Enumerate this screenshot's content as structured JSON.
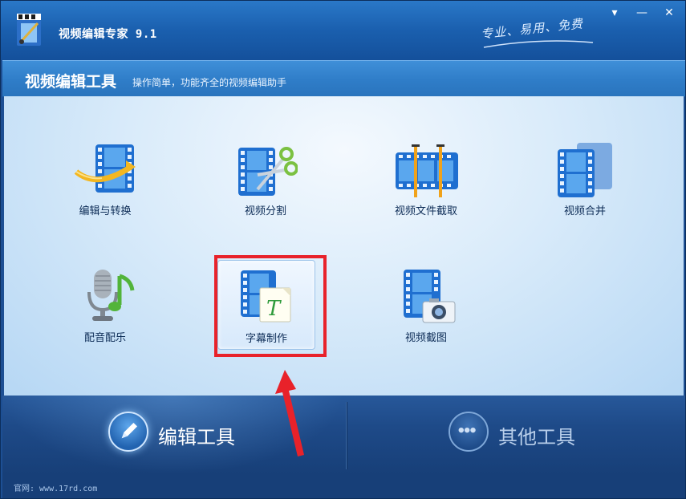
{
  "window": {
    "title": "视频编辑专家 9.1",
    "slogan": "专业、易用、免费",
    "controls": {
      "menu": "▾",
      "minimize": "—",
      "close": "✕"
    }
  },
  "header": {
    "title": "视频编辑工具",
    "subtitle": "操作简单，功能齐全的视频编辑助手"
  },
  "tools": [
    {
      "label": "编辑与转换",
      "icon": "film-convert-icon"
    },
    {
      "label": "视频分割",
      "icon": "film-scissors-icon"
    },
    {
      "label": "视频文件截取",
      "icon": "film-trim-icon"
    },
    {
      "label": "视频合并",
      "icon": "film-merge-icon"
    },
    {
      "label": "配音配乐",
      "icon": "microphone-music-icon"
    },
    {
      "label": "字幕制作",
      "icon": "film-subtitle-icon",
      "selected": true
    },
    {
      "label": "视频截图",
      "icon": "film-camera-icon"
    }
  ],
  "bottom_nav": {
    "edit_tools": {
      "label": "编辑工具",
      "icon": "pencil-icon",
      "active": true
    },
    "other_tools": {
      "label": "其他工具",
      "icon": "more-dots-icon",
      "active": false
    }
  },
  "footer": {
    "text": "官网: www.17rd.com"
  },
  "colors": {
    "highlight_box": "#e8222a",
    "film_blue": "#1f6fd0",
    "title_bar": "#1a5fae"
  }
}
